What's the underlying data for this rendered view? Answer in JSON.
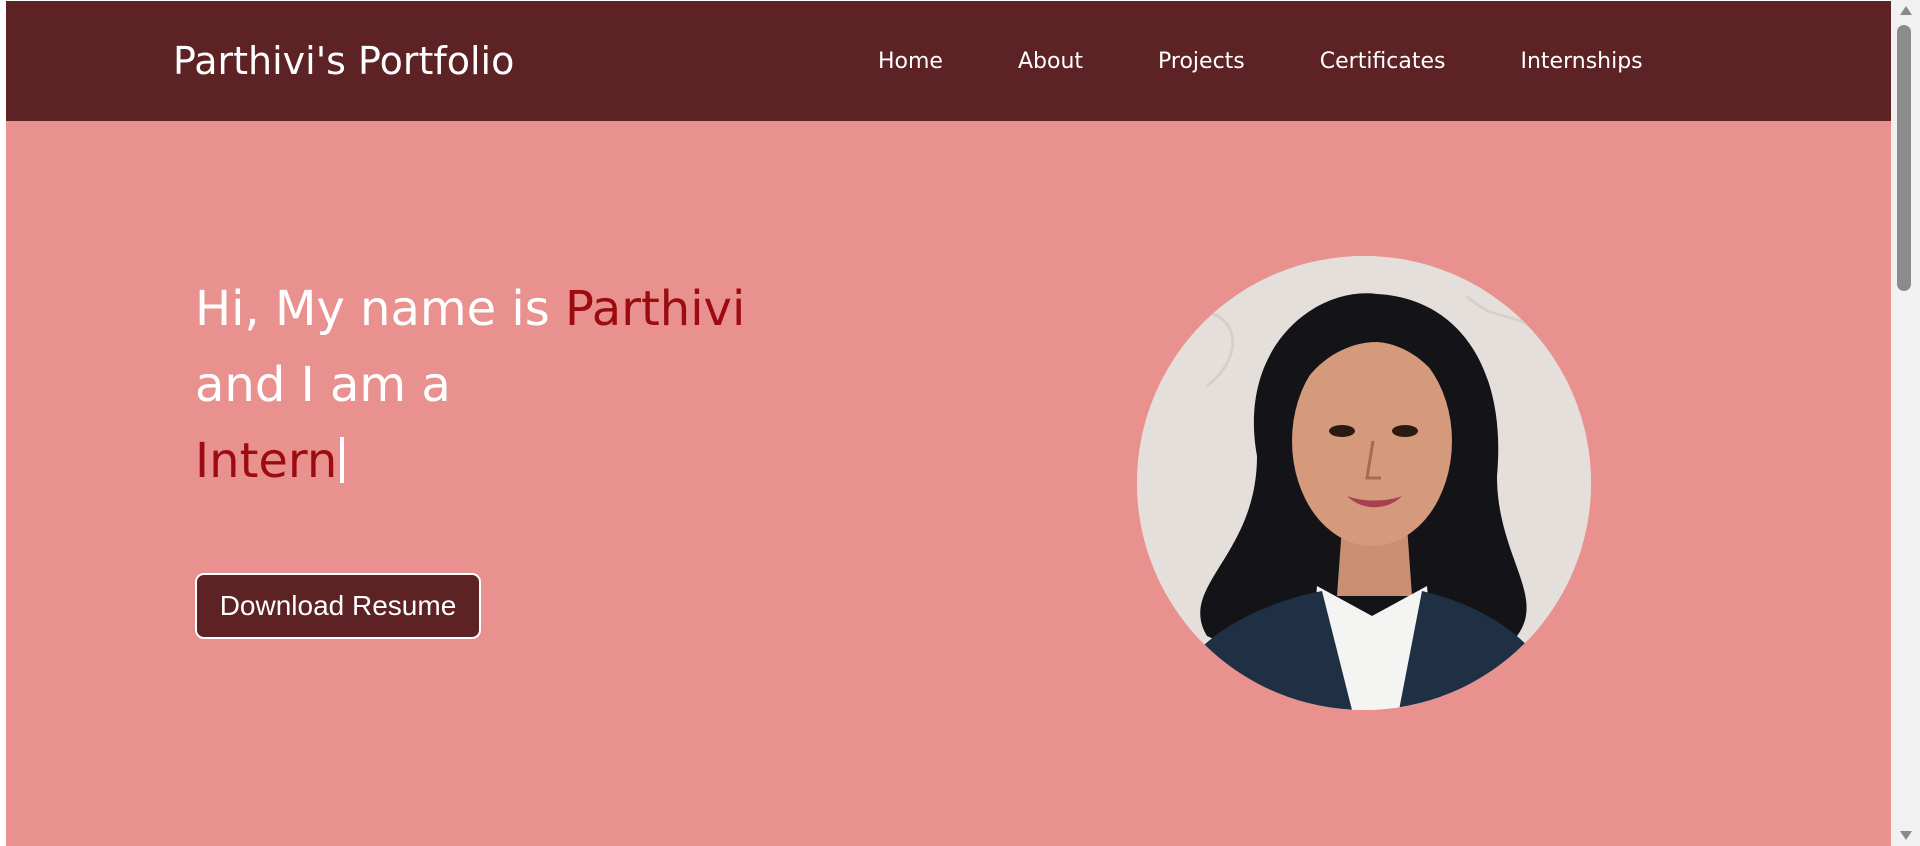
{
  "navbar": {
    "brand": "Parthivi's Portfolio",
    "links": [
      "Home",
      "About",
      "Projects",
      "Certificates",
      "Internships"
    ]
  },
  "hero": {
    "line1_prefix": "Hi, My name is ",
    "name": "Parthivi",
    "line2": "and I am a",
    "role": "Intern",
    "button_label": "Download Resume"
  },
  "colors": {
    "navbar_bg": "#5c2224",
    "page_bg": "#e8918f",
    "accent": "#9b0b10",
    "text": "#ffffff"
  },
  "icons": {
    "profile_photo": "profile-photo",
    "scroll_up": "triangle-up",
    "scroll_down": "triangle-down"
  }
}
